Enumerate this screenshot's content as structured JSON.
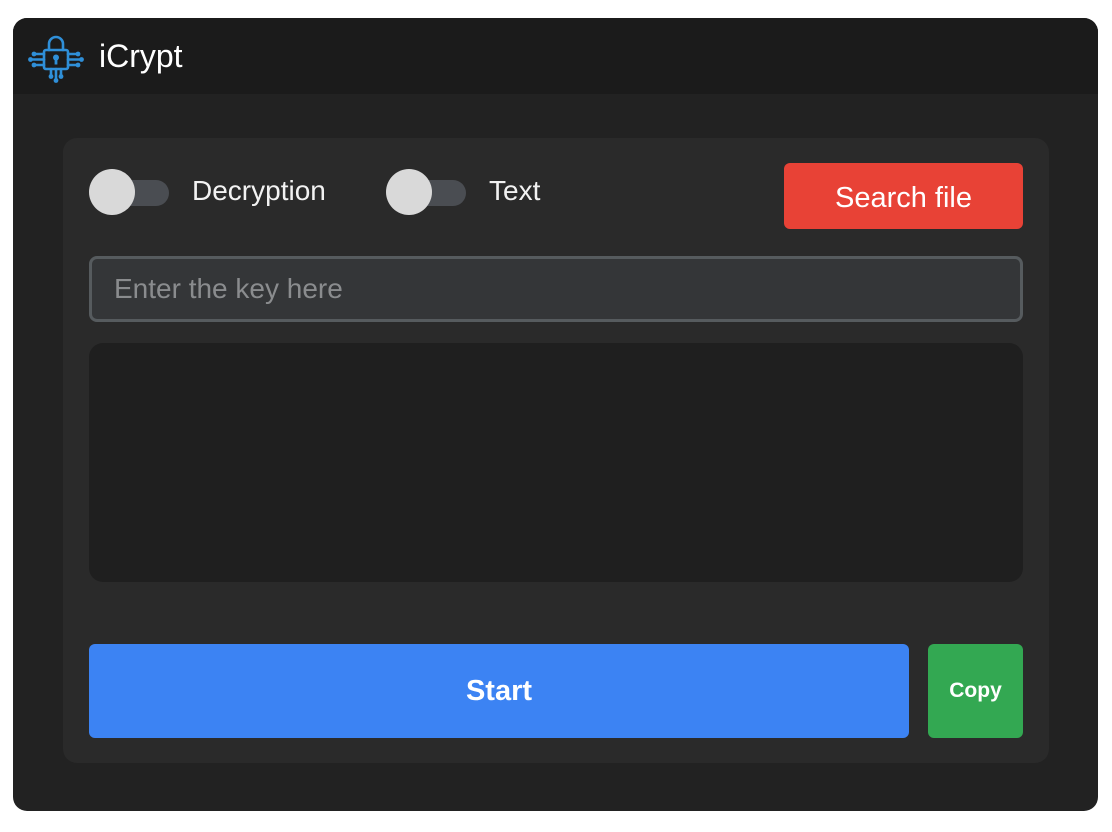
{
  "window": {
    "title": "iCrypt",
    "app_icon": "lock-circuit-icon"
  },
  "controls": {
    "mode_toggle": {
      "label": "Decryption",
      "checked": false
    },
    "input_type_toggle": {
      "label": "Text",
      "checked": false
    },
    "search_file_label": "Search file",
    "key_input": {
      "placeholder": "Enter the key here",
      "value": ""
    },
    "output_text": ""
  },
  "actions": {
    "start_label": "Start",
    "copy_label": "Copy"
  },
  "colors": {
    "accent_icon": "#2f8fd8",
    "search_button": "#e84236",
    "start_button": "#3c83f3",
    "copy_button": "#33a852"
  }
}
